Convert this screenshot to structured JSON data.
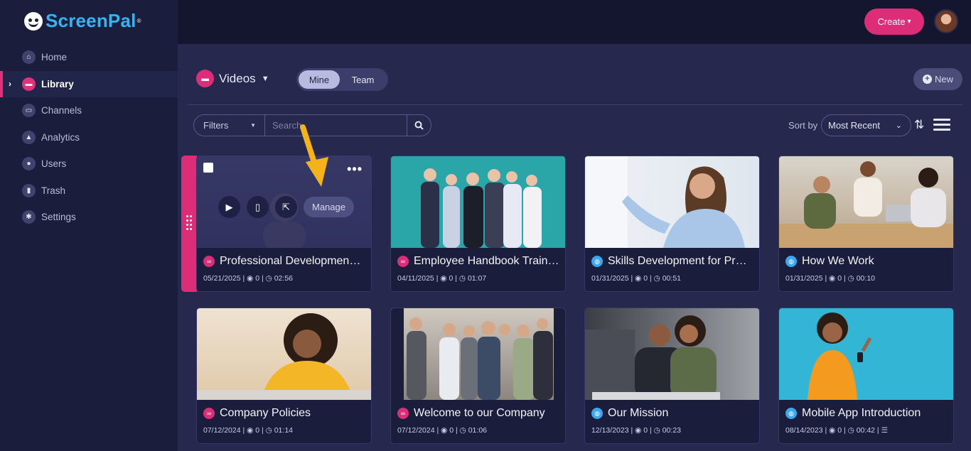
{
  "app": {
    "logo_text": "ScreenPal",
    "logo_mark": "®"
  },
  "sidebar": {
    "items": [
      {
        "label": "Home",
        "icon": "home-icon",
        "glyph": "⌂"
      },
      {
        "label": "Library",
        "icon": "folder-icon",
        "glyph": "▬",
        "active": true
      },
      {
        "label": "Channels",
        "icon": "channels-icon",
        "glyph": "▭"
      },
      {
        "label": "Analytics",
        "icon": "analytics-icon",
        "glyph": "▲"
      },
      {
        "label": "Users",
        "icon": "user-icon",
        "glyph": "●"
      },
      {
        "label": "Trash",
        "icon": "trash-icon",
        "glyph": "▮"
      },
      {
        "label": "Settings",
        "icon": "gear-icon",
        "glyph": "✱"
      }
    ]
  },
  "topbar": {
    "create_label": "Create",
    "create_caret": "▾"
  },
  "library": {
    "title": "Videos",
    "scope_tabs": [
      "Mine",
      "Team"
    ],
    "new_label": "New"
  },
  "filters": {
    "filters_label": "Filters",
    "search_placeholder": "Search",
    "sort_by_label": "Sort by",
    "sort_value": "Most Recent"
  },
  "cards": [
    {
      "title": "Professional Developmen…",
      "date": "05/21/2025",
      "views": "0",
      "duration": "02:56",
      "type": "link",
      "selected": true
    },
    {
      "title": "Employee Handbook Train…",
      "date": "04/11/2025",
      "views": "0",
      "duration": "01:07",
      "type": "link"
    },
    {
      "title": "Skills Development for Pr…",
      "date": "01/31/2025",
      "views": "0",
      "duration": "00:51",
      "type": "pub"
    },
    {
      "title": "How We Work",
      "date": "01/31/2025",
      "views": "0",
      "duration": "00:10",
      "type": "pub"
    },
    {
      "title": "Company Policies",
      "date": "07/12/2024",
      "views": "0",
      "duration": "01:14",
      "type": "link"
    },
    {
      "title": "Welcome to our Company",
      "date": "07/12/2024",
      "views": "0",
      "duration": "01:06",
      "type": "link"
    },
    {
      "title": "Our Mission",
      "date": "12/13/2023",
      "views": "0",
      "duration": "00:23",
      "type": "pub"
    },
    {
      "title": "Mobile App Introduction",
      "date": "08/14/2023",
      "views": "0",
      "duration": "00:42",
      "type": "pub",
      "has_captions": true
    }
  ],
  "card_overlay": {
    "manage_label": "Manage",
    "more_glyph": "•••"
  },
  "colors": {
    "accent": "#de2d78",
    "link_badge": "#de2d78",
    "public_badge": "#39a8f0",
    "sidebar_bg": "#1b1d3d",
    "content_bg": "#26284e"
  }
}
